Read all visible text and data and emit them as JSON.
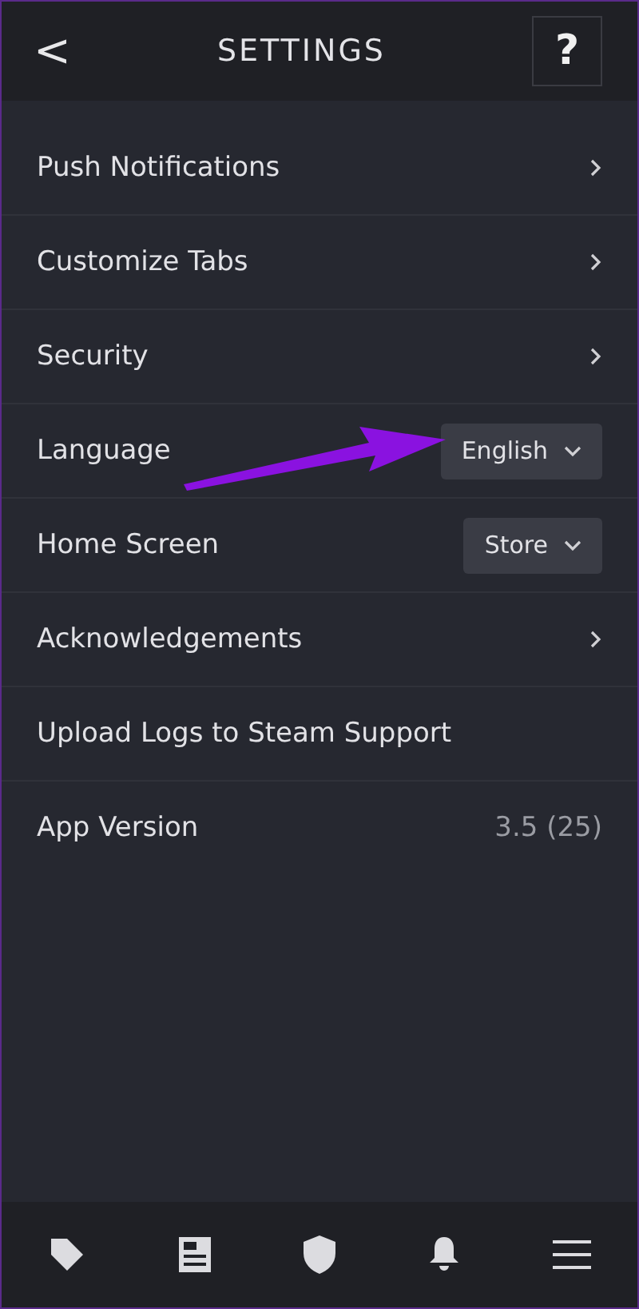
{
  "header": {
    "back": "<",
    "title": "SETTINGS",
    "help": "?"
  },
  "rows": [
    {
      "kind": "link",
      "label": "Push Notifications"
    },
    {
      "kind": "link",
      "label": "Customize Tabs"
    },
    {
      "kind": "link",
      "label": "Security"
    },
    {
      "kind": "dropdown",
      "label": "Language",
      "value": "English"
    },
    {
      "kind": "dropdown",
      "label": "Home Screen",
      "value": "Store"
    },
    {
      "kind": "link",
      "label": "Acknowledgements"
    },
    {
      "kind": "plain",
      "label": "Upload Logs to Steam Support"
    },
    {
      "kind": "value",
      "label": "App Version",
      "value": "3.5 (25)"
    }
  ],
  "nav": [
    {
      "kind": "tag"
    },
    {
      "kind": "news"
    },
    {
      "kind": "shield"
    },
    {
      "kind": "bell"
    },
    {
      "kind": "menu"
    }
  ]
}
